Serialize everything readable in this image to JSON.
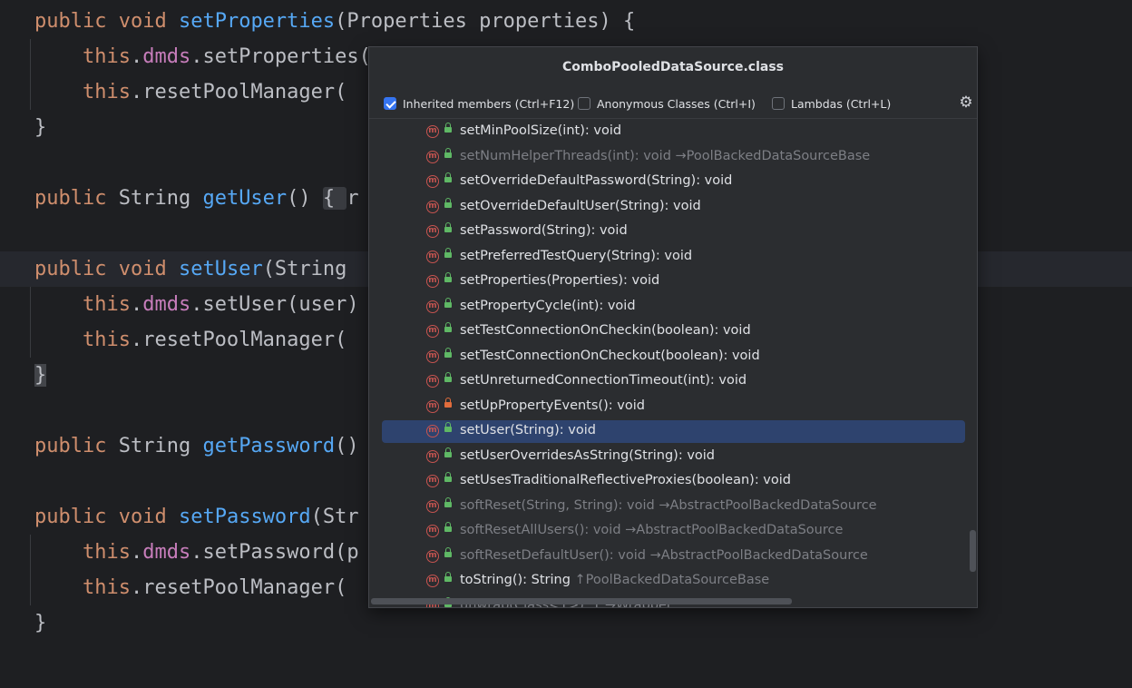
{
  "editor": {
    "lines": [
      [
        {
          "t": "public",
          "c": "kw"
        },
        {
          "t": " "
        },
        {
          "t": "void",
          "c": "kw"
        },
        {
          "t": " "
        },
        {
          "t": "setProperties",
          "c": "fn"
        },
        {
          "t": "(Properties properties) {"
        }
      ],
      [
        {
          "t": "    "
        },
        {
          "t": "this",
          "c": "kw"
        },
        {
          "t": "."
        },
        {
          "t": "dmds",
          "c": "fld"
        },
        {
          "t": ".setProperties("
        }
      ],
      [
        {
          "t": "    "
        },
        {
          "t": "this",
          "c": "kw"
        },
        {
          "t": ".resetPoolManager("
        }
      ],
      [
        {
          "t": "}"
        }
      ],
      [],
      [
        {
          "t": "public",
          "c": "kw"
        },
        {
          "t": " String "
        },
        {
          "t": "getUser",
          "c": "fn"
        },
        {
          "t": "() "
        },
        {
          "t": "{ ",
          "c": "fold-box"
        },
        {
          "t": "r"
        }
      ],
      [],
      [
        {
          "t": "public",
          "c": "kw"
        },
        {
          "t": " "
        },
        {
          "t": "void",
          "c": "kw"
        },
        {
          "t": " "
        },
        {
          "t": "setUser",
          "c": "fn"
        },
        {
          "t": "(String"
        }
      ],
      [
        {
          "t": "    "
        },
        {
          "t": "this",
          "c": "kw"
        },
        {
          "t": "."
        },
        {
          "t": "dmds",
          "c": "fld"
        },
        {
          "t": ".setUser(user)"
        }
      ],
      [
        {
          "t": "    "
        },
        {
          "t": "this",
          "c": "kw"
        },
        {
          "t": ".resetPoolManager("
        }
      ],
      [
        {
          "t": "}",
          "c": "brace-hl"
        }
      ],
      [],
      [
        {
          "t": "public",
          "c": "kw"
        },
        {
          "t": " String "
        },
        {
          "t": "getPassword",
          "c": "fn"
        },
        {
          "t": "()"
        }
      ],
      [],
      [
        {
          "t": "public",
          "c": "kw"
        },
        {
          "t": " "
        },
        {
          "t": "void",
          "c": "kw"
        },
        {
          "t": " "
        },
        {
          "t": "setPassword",
          "c": "fn"
        },
        {
          "t": "(Str"
        }
      ],
      [
        {
          "t": "    "
        },
        {
          "t": "this",
          "c": "kw"
        },
        {
          "t": "."
        },
        {
          "t": "dmds",
          "c": "fld"
        },
        {
          "t": ".setPassword(p"
        }
      ],
      [
        {
          "t": "    "
        },
        {
          "t": "this",
          "c": "kw"
        },
        {
          "t": ".resetPoolManager("
        }
      ],
      [
        {
          "t": "}"
        }
      ]
    ]
  },
  "popup": {
    "title": "ComboPooledDataSource.class",
    "filters": {
      "inherited": {
        "label": "Inherited members (Ctrl+F12)",
        "checked": true
      },
      "anonymous": {
        "label": "Anonymous Classes (Ctrl+I)",
        "checked": false
      },
      "lambdas": {
        "label": "Lambdas (Ctrl+L)",
        "checked": false
      }
    },
    "gear_icon": "gear-icon",
    "items": [
      {
        "sig": "setMinPoolSize(int): void",
        "origin": "",
        "inherited": false,
        "access": "public"
      },
      {
        "sig": "setNumHelperThreads(int): void",
        "origin": "→PoolBackedDataSourceBase",
        "inherited": true,
        "access": "public"
      },
      {
        "sig": "setOverrideDefaultPassword(String): void",
        "origin": "",
        "inherited": false,
        "access": "public"
      },
      {
        "sig": "setOverrideDefaultUser(String): void",
        "origin": "",
        "inherited": false,
        "access": "public"
      },
      {
        "sig": "setPassword(String): void",
        "origin": "",
        "inherited": false,
        "access": "public"
      },
      {
        "sig": "setPreferredTestQuery(String): void",
        "origin": "",
        "inherited": false,
        "access": "public"
      },
      {
        "sig": "setProperties(Properties): void",
        "origin": "",
        "inherited": false,
        "access": "public"
      },
      {
        "sig": "setPropertyCycle(int): void",
        "origin": "",
        "inherited": false,
        "access": "public"
      },
      {
        "sig": "setTestConnectionOnCheckin(boolean): void",
        "origin": "",
        "inherited": false,
        "access": "public"
      },
      {
        "sig": "setTestConnectionOnCheckout(boolean): void",
        "origin": "",
        "inherited": false,
        "access": "public"
      },
      {
        "sig": "setUnreturnedConnectionTimeout(int): void",
        "origin": "",
        "inherited": false,
        "access": "public"
      },
      {
        "sig": "setUpPropertyEvents(): void",
        "origin": "",
        "inherited": false,
        "access": "private"
      },
      {
        "sig": "setUser(String): void",
        "origin": "",
        "inherited": false,
        "access": "public",
        "selected": true
      },
      {
        "sig": "setUserOverridesAsString(String): void",
        "origin": "",
        "inherited": false,
        "access": "public"
      },
      {
        "sig": "setUsesTraditionalReflectiveProxies(boolean): void",
        "origin": "",
        "inherited": false,
        "access": "public"
      },
      {
        "sig": "softReset(String, String): void",
        "origin": "→AbstractPoolBackedDataSource",
        "inherited": true,
        "access": "public"
      },
      {
        "sig": "softResetAllUsers(): void",
        "origin": "→AbstractPoolBackedDataSource",
        "inherited": true,
        "access": "public"
      },
      {
        "sig": "softResetDefaultUser(): void",
        "origin": "→AbstractPoolBackedDataSource",
        "inherited": true,
        "access": "public"
      },
      {
        "sig": "toString(): String",
        "origin": "↑PoolBackedDataSourceBase",
        "inherited": false,
        "access": "public"
      },
      {
        "sig": "unwrap(Class<T>): T",
        "origin": "→Wrapper",
        "inherited": true,
        "access": "public"
      }
    ]
  }
}
